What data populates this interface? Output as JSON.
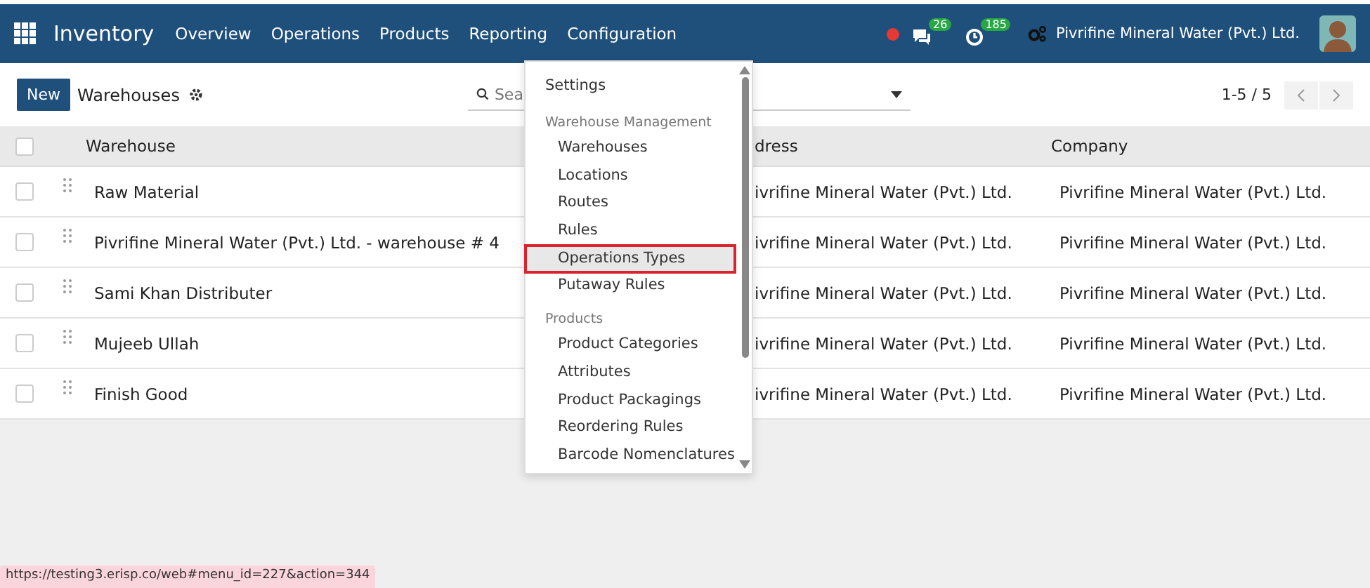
{
  "navbar": {
    "app_name": "Inventory",
    "menu": [
      "Overview",
      "Operations",
      "Products",
      "Reporting",
      "Configuration"
    ],
    "messages_count": "26",
    "activities_count": "185",
    "company": "Pivrifine Mineral Water (Pvt.) Ltd."
  },
  "control_panel": {
    "new_button": "New",
    "breadcrumb": "Warehouses",
    "search": {
      "placeholder": "Sea"
    },
    "pager": "1-5 / 5"
  },
  "table": {
    "select_all_checked": false,
    "columns": [
      "Warehouse",
      "dress",
      "Company"
    ],
    "rows": [
      {
        "name": "Raw Material",
        "address": "ivrifine Mineral Water (Pvt.) Ltd.",
        "company": "Pivrifine Mineral Water (Pvt.) Ltd.",
        "checked": false
      },
      {
        "name": "Pivrifine Mineral Water (Pvt.) Ltd. - warehouse # 4",
        "address": "ivrifine Mineral Water (Pvt.) Ltd.",
        "company": "Pivrifine Mineral Water (Pvt.) Ltd.",
        "checked": false
      },
      {
        "name": "Sami Khan Distributer",
        "address": "ivrifine Mineral Water (Pvt.) Ltd.",
        "company": "Pivrifine Mineral Water (Pvt.) Ltd.",
        "checked": false
      },
      {
        "name": "Mujeeb Ullah",
        "address": "ivrifine Mineral Water (Pvt.) Ltd.",
        "company": "Pivrifine Mineral Water (Pvt.) Ltd.",
        "checked": false
      },
      {
        "name": "Finish Good",
        "address": "ivrifine Mineral Water (Pvt.) Ltd.",
        "company": "Pivrifine Mineral Water (Pvt.) Ltd.",
        "checked": false
      }
    ]
  },
  "dropdown": {
    "items": [
      {
        "kind": "item",
        "label": "Settings",
        "selected": false
      },
      {
        "kind": "header",
        "label": "Warehouse Management"
      },
      {
        "kind": "subitem",
        "label": "Warehouses",
        "selected": false
      },
      {
        "kind": "subitem",
        "label": "Locations",
        "selected": false
      },
      {
        "kind": "subitem",
        "label": "Routes",
        "selected": false
      },
      {
        "kind": "subitem",
        "label": "Rules",
        "selected": false
      },
      {
        "kind": "subitem",
        "label": "Operations Types",
        "selected": true
      },
      {
        "kind": "subitem",
        "label": "Putaway Rules",
        "selected": false
      },
      {
        "kind": "header",
        "label": "Products"
      },
      {
        "kind": "subitem",
        "label": "Product Categories",
        "selected": false
      },
      {
        "kind": "subitem",
        "label": "Attributes",
        "selected": false
      },
      {
        "kind": "subitem",
        "label": "Product Packagings",
        "selected": false
      },
      {
        "kind": "subitem",
        "label": "Reordering Rules",
        "selected": false
      },
      {
        "kind": "subitem",
        "label": "Barcode Nomenclatures",
        "selected": false
      }
    ]
  },
  "status_bar": {
    "url": "https://testing3.erisp.co/web#menu_id=227&action=344"
  }
}
